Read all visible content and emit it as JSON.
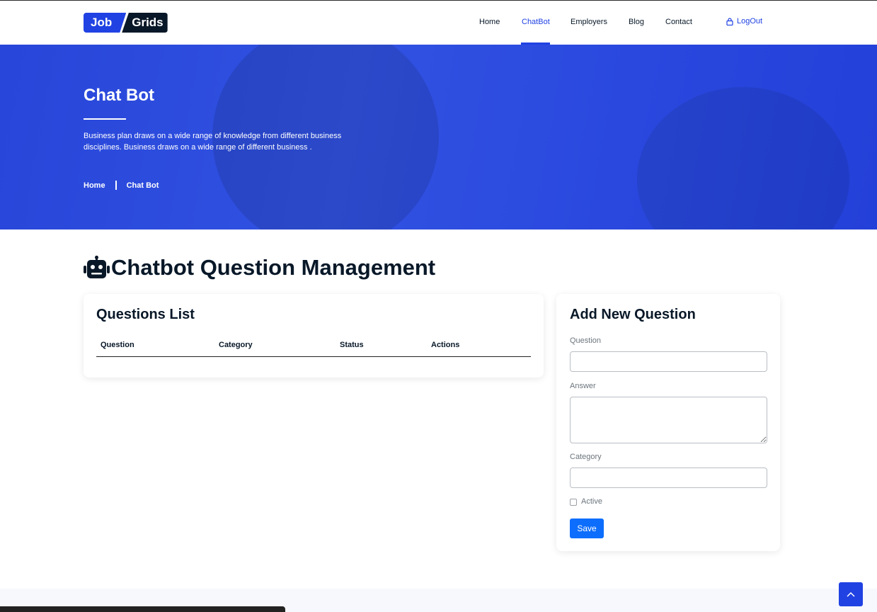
{
  "brand": {
    "logo_part1": "Job",
    "logo_part2": "Grids",
    "accent": "#2042e3",
    "dark": "#081828"
  },
  "nav": {
    "items": [
      {
        "label": "Home",
        "active": false
      },
      {
        "label": "ChatBot",
        "active": true
      },
      {
        "label": "Employers",
        "active": false
      },
      {
        "label": "Blog",
        "active": false
      },
      {
        "label": "Contact",
        "active": false
      }
    ],
    "logout_label": "LogOut",
    "logout_icon": "lock-icon"
  },
  "hero": {
    "title": "Chat Bot",
    "description": "Business plan draws on a wide range of knowledge from different business disciplines. Business draws on a wide range of different business .",
    "breadcrumb": [
      "Home",
      "Chat Bot"
    ]
  },
  "main": {
    "title": "Chatbot Question Management",
    "title_icon": "robot-icon"
  },
  "questions_list": {
    "title": "Questions List",
    "columns": [
      "Question",
      "Category",
      "Status",
      "Actions"
    ],
    "rows": []
  },
  "add_question": {
    "title": "Add New Question",
    "question_label": "Question",
    "question_value": "",
    "answer_label": "Answer",
    "answer_value": "",
    "category_label": "Category",
    "category_value": "",
    "active_label": "Active",
    "active_checked": false,
    "save_label": "Save",
    "save_color": "#0d6efd"
  },
  "scroll_top_icon": "chevron-up-icon"
}
